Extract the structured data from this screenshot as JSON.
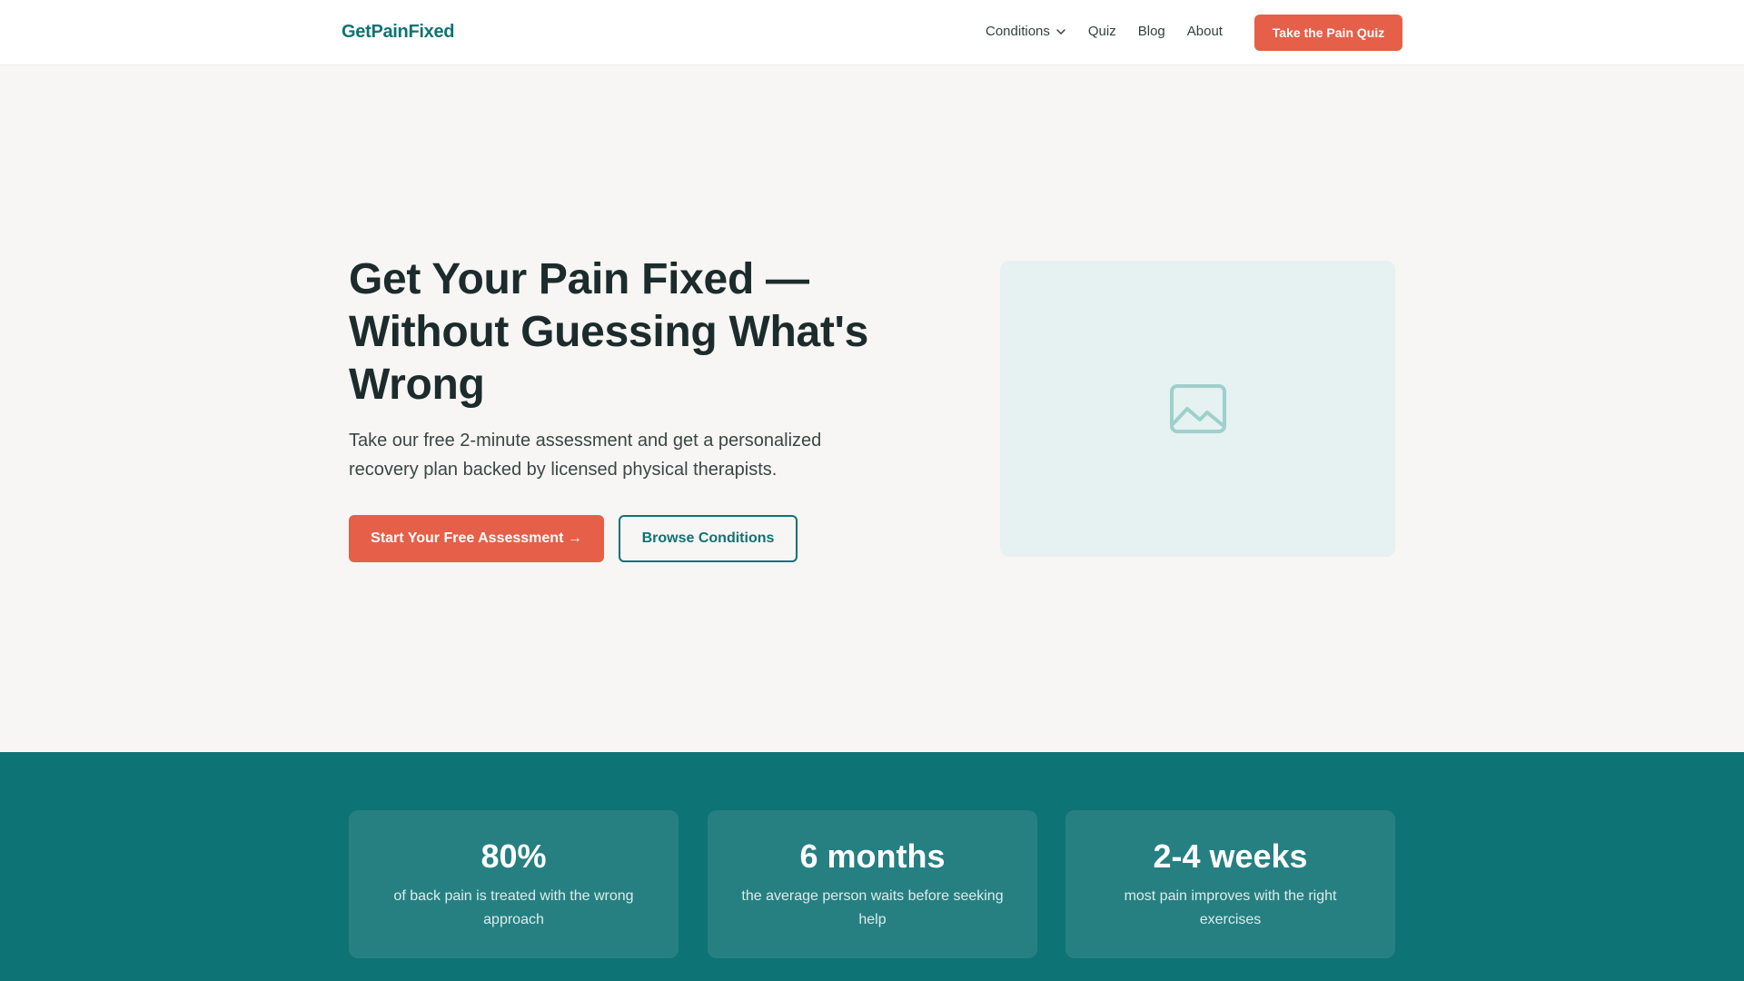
{
  "header": {
    "logo": "GetPainFixed",
    "nav": [
      {
        "label": "Conditions",
        "icon": "chevron-down-icon"
      },
      {
        "label": "Quiz"
      },
      {
        "label": "Blog"
      },
      {
        "label": "About"
      }
    ],
    "cta": "Take the Pain Quiz"
  },
  "hero": {
    "title": "Get Your Pain Fixed — Without Guessing What's Wrong",
    "subtitle": "Take our free 2-minute assessment and get a personalized recovery plan backed by licensed physical therapists.",
    "primary_button": "Start Your Free Assessment →",
    "secondary_button": "Browse Conditions",
    "image_icon": "image-placeholder-icon"
  },
  "stats": [
    {
      "value": "80%",
      "label": "of back pain is treated with the wrong approach"
    },
    {
      "value": "6 months",
      "label": "the average person waits before seeking help"
    },
    {
      "value": "2-4 weeks",
      "label": "most pain improves with the right exercises"
    }
  ],
  "colors": {
    "brand": "#0e7374",
    "accent": "#e65f48",
    "background": "#f7f6f4",
    "image_placeholder": "#e5f2f1"
  }
}
